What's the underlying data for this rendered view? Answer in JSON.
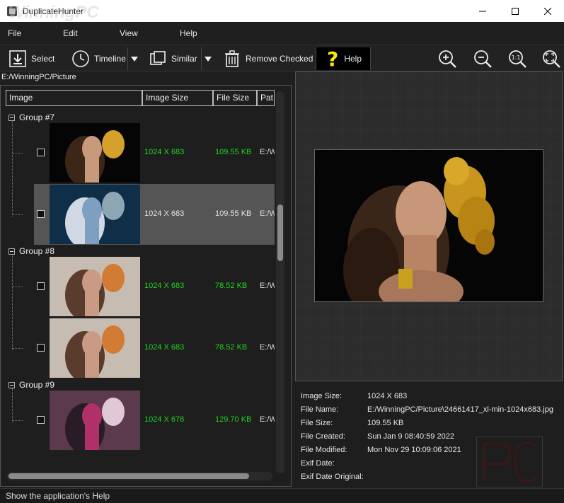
{
  "window": {
    "title": "DuplicateHunter",
    "watermark": "WinningPC"
  },
  "menu": [
    "File",
    "Edit",
    "View",
    "Help"
  ],
  "toolbar": {
    "select": "Select",
    "timeline": "Timeline",
    "similar": "Similar",
    "remove_checked": "Remove Checked",
    "help": "Help",
    "zoom_actual_label": "1:1"
  },
  "path": "E:/WinningPC/Picture",
  "columns": [
    "Image",
    "Image Size",
    "File Size",
    "Pat"
  ],
  "groups": [
    {
      "label": "Group #7",
      "rows": [
        {
          "image_size": "1024 X 683",
          "file_size": "109.55 KB",
          "path": "E:/W",
          "checked": false,
          "highlight": true,
          "selected": false,
          "thumb": "gold"
        },
        {
          "image_size": "1024 X 683",
          "file_size": "109.55 KB",
          "path": "E:/W",
          "checked": false,
          "highlight": false,
          "selected": true,
          "thumb": "blue"
        }
      ]
    },
    {
      "label": "Group #8",
      "rows": [
        {
          "image_size": "1024 X 683",
          "file_size": "78.52 KB",
          "path": "E:/W",
          "checked": false,
          "highlight": true,
          "selected": false,
          "thumb": "warm"
        },
        {
          "image_size": "1024 X 683",
          "file_size": "78.52 KB",
          "path": "E:/W",
          "checked": false,
          "highlight": true,
          "selected": false,
          "thumb": "warm"
        }
      ]
    },
    {
      "label": "Group #9",
      "rows": [
        {
          "image_size": "1024 X 678",
          "file_size": "129.70 KB",
          "path": "E:/W",
          "checked": false,
          "highlight": true,
          "selected": false,
          "thumb": "pink"
        }
      ]
    }
  ],
  "details": {
    "image_size_label": "Image Size:",
    "image_size": "1024 X 683",
    "file_name_label": "File Name:",
    "file_name": "E:/WinningPC/Picture\\24661417_xl-min-1024x683.jpg",
    "file_size_label": "File Size:",
    "file_size": "109.55 KB",
    "file_created_label": "File Created:",
    "file_created": "Sun Jan 9 08:40:59 2022",
    "file_modified_label": "File Modified:",
    "file_modified": "Mon Nov 29 10:09:06 2021",
    "exif_date_label": "Exif Date:",
    "exif_date": "",
    "exif_date_original_label": "Exif Date Original:",
    "exif_date_original": ""
  },
  "status": "Show the application's Help",
  "colors": {
    "highlight_green": "#22d322",
    "selected_row": "#555555",
    "background": "#1f1f1f"
  }
}
